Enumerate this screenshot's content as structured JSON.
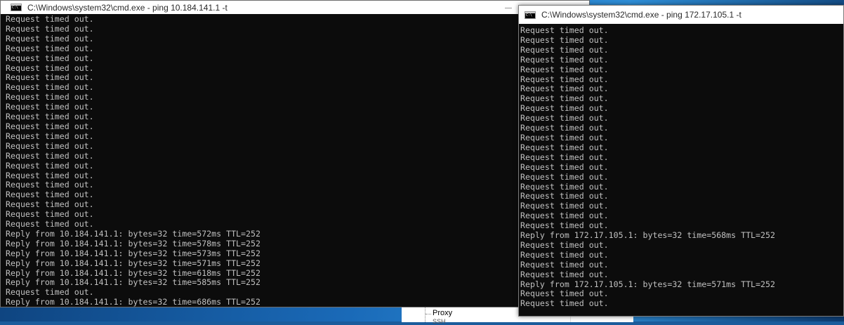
{
  "window_left": {
    "title": "C:\\Windows\\system32\\cmd.exe - ping  10.184.141.1 -t",
    "lines": [
      "Request timed out.",
      "Request timed out.",
      "Request timed out.",
      "Request timed out.",
      "Request timed out.",
      "Request timed out.",
      "Request timed out.",
      "Request timed out.",
      "Request timed out.",
      "Request timed out.",
      "Request timed out.",
      "Request timed out.",
      "Request timed out.",
      "Request timed out.",
      "Request timed out.",
      "Request timed out.",
      "Request timed out.",
      "Request timed out.",
      "Request timed out.",
      "Request timed out.",
      "Request timed out.",
      "Request timed out.",
      "Reply from 10.184.141.1: bytes=32 time=572ms TTL=252",
      "Reply from 10.184.141.1: bytes=32 time=578ms TTL=252",
      "Reply from 10.184.141.1: bytes=32 time=573ms TTL=252",
      "Reply from 10.184.141.1: bytes=32 time=571ms TTL=252",
      "Reply from 10.184.141.1: bytes=32 time=618ms TTL=252",
      "Reply from 10.184.141.1: bytes=32 time=585ms TTL=252",
      "Request timed out.",
      "Reply from 10.184.141.1: bytes=32 time=686ms TTL=252"
    ]
  },
  "window_right": {
    "title": "C:\\Windows\\system32\\cmd.exe - ping  172.17.105.1 -t",
    "lines": [
      "Request timed out.",
      "Request timed out.",
      "Request timed out.",
      "Request timed out.",
      "Request timed out.",
      "Request timed out.",
      "Request timed out.",
      "Request timed out.",
      "Request timed out.",
      "Request timed out.",
      "Request timed out.",
      "Request timed out.",
      "Request timed out.",
      "Request timed out.",
      "Request timed out.",
      "Request timed out.",
      "Request timed out.",
      "Request timed out.",
      "Request timed out.",
      "Request timed out.",
      "Request timed out.",
      "Reply from 172.17.105.1: bytes=32 time=568ms TTL=252",
      "Request timed out.",
      "Request timed out.",
      "Request timed out.",
      "Request timed out.",
      "Reply from 172.17.105.1: bytes=32 time=571ms TTL=252",
      "Request timed out.",
      "Request timed out."
    ]
  },
  "background_window": {
    "tree_item": "Proxy",
    "tree_item_next": "SSH"
  },
  "colors": {
    "console_bg": "#0c0c0c",
    "console_text": "#c0c0c0",
    "titlebar_bg": "#ffffff"
  }
}
